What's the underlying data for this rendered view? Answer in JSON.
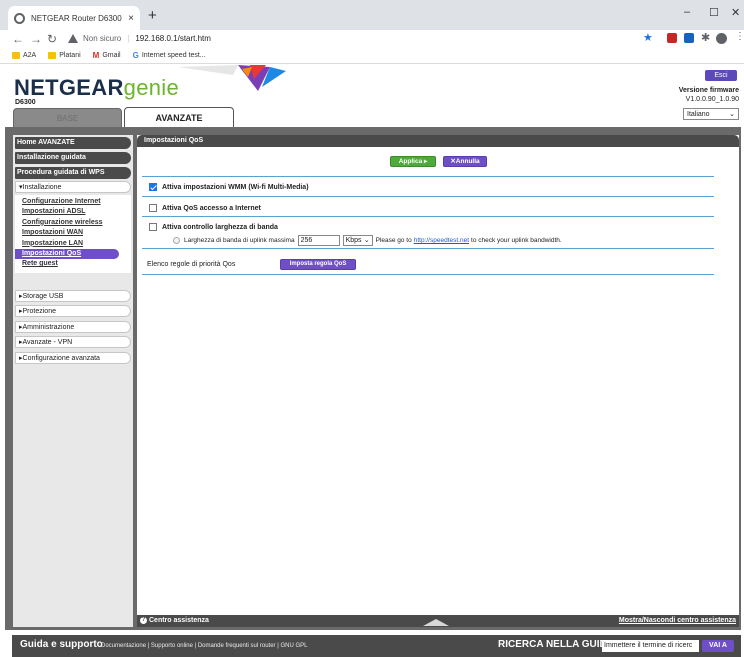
{
  "browser": {
    "tab_title": "NETGEAR Router D6300",
    "tab_close": "×",
    "new_tab": "+",
    "insecure_label": "Non sicuro",
    "url": "192.168.0.1/start.htm",
    "bookmarks": [
      "A2A",
      "Platani",
      "Gmail",
      "Internet speed test..."
    ]
  },
  "header": {
    "brand": "NETGEAR",
    "brand_suffix": "genie",
    "model": "D6300",
    "exit_label": "Esci",
    "firmware_label": "Versione firmware",
    "firmware_value": "V1.0.0.90_1.0.90",
    "language": "Italiano",
    "tab_basic": "BASE",
    "tab_advanced": "AVANZATE"
  },
  "sidebar": {
    "home": "Home AVANZATE",
    "setup_wizard": "Installazione guidata",
    "wps": "Procedura guidata di WPS",
    "install_open": "▾Installazione",
    "links": [
      "Configurazione Internet",
      "Impostazioni ADSL",
      "Configurazione wireless",
      "Impostazioni WAN",
      "Impostazione LAN",
      "Impostazioni QoS",
      "Rete guest"
    ],
    "storage": "▸Storage USB",
    "security": "▸Protezione",
    "admin": "▸Amministrazione",
    "vpn": "▸Avanzate - VPN",
    "advanced_config": "▸Configurazione avanzata"
  },
  "content": {
    "title": "Impostazioni QoS",
    "apply": "Applica ▸",
    "cancel": "✕Annulla",
    "wmm": "Attiva impostazioni WMM (Wi-fi Multi-Media)",
    "qos_internet": "Attiva QoS accesso a Internet",
    "bw_control": "Attiva controllo larghezza di banda",
    "bw_label": "Larghezza di banda di uplink massima",
    "bw_value": "256",
    "bw_unit": "Kbps",
    "bw_note_pre": "Please go to",
    "bw_link": "http://speedtest.net",
    "bw_note_post": "to check your uplink bandwidth.",
    "prio_label": "Elenco regole di priorità Qos",
    "prio_button": "Imposta regola QoS"
  },
  "help": {
    "left": "Centro assistenza",
    "right": "Mostra/Nascondi centro assistenza"
  },
  "footer": {
    "title": "Guida e supporto",
    "links": "Documentazione | Supporto online | Domande frequenti sul router | GNU GPL",
    "search_label": "RICERCA NELLA GUIDA",
    "search_placeholder": "Immettere il termine di ricerc",
    "go": "VAI A"
  },
  "colors": {
    "accent": "#6f4fc7",
    "apply": "#4faa3c",
    "divider": "#5ca1d3"
  }
}
